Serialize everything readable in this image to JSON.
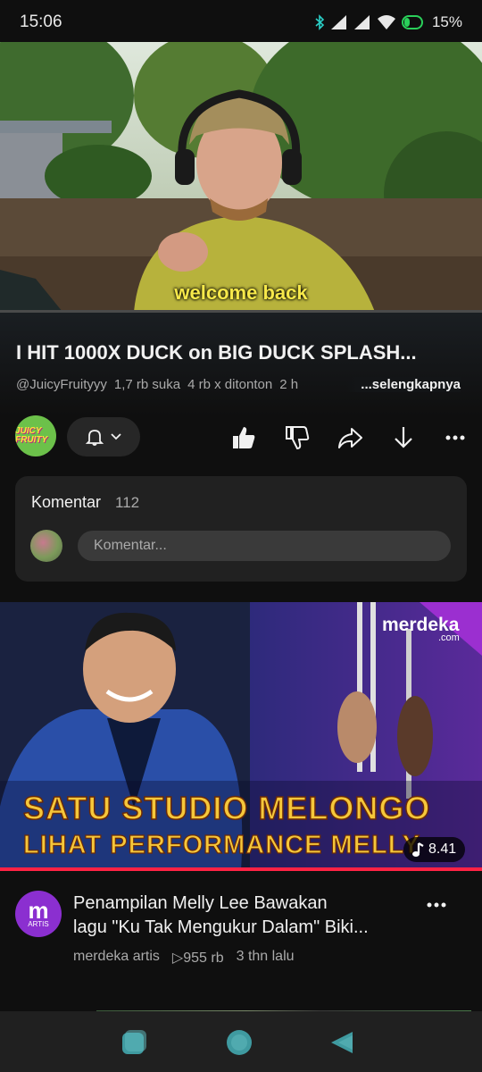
{
  "status_bar": {
    "time": "15:06",
    "battery": "15%"
  },
  "player": {
    "caption": "welcome back",
    "progress": 0.0
  },
  "video": {
    "title": "I HIT 1000X DUCK on BIG DUCK SPLASH...",
    "channel_handle": "@JuicyFruityyy",
    "likes": "1,7 rb suka",
    "views": "4 rb x ditonton",
    "age": "2 h",
    "more_label": "...selengkapnya",
    "channel_avatar_text": "JUICY FRUITY"
  },
  "actions": {
    "bell_icon": "bell-icon",
    "like_icon": "thumbs-up-icon",
    "dislike_icon": "thumbs-down-icon",
    "share_icon": "share-icon",
    "download_icon": "download-icon",
    "more_icon": "more-icon"
  },
  "comments": {
    "label": "Komentar",
    "count": "112",
    "placeholder": "Komentar..."
  },
  "recommended": {
    "thumbnail_line1": "SATU STUDIO MELONGO",
    "thumbnail_line2": "LIHAT PERFORMANCE MELLY",
    "thumbnail_logo": "merdeka",
    "thumbnail_logo_sub": ".com",
    "duration": "8.41",
    "avatar_letter": "m",
    "avatar_sub": "ARTIS",
    "title_line1": "Penampilan Melly Lee Bawakan",
    "title_line2": "lagu \"Ku Tak Mengukur Dalam\" Biki...",
    "channel": "merdeka artis",
    "views": "▷955 rb",
    "age": "3 thn lalu"
  },
  "colors": {
    "background": "#0f0f0f",
    "accent_red": "#ff0000",
    "caption_yellow": "#f7e94a",
    "card": "#212121"
  }
}
